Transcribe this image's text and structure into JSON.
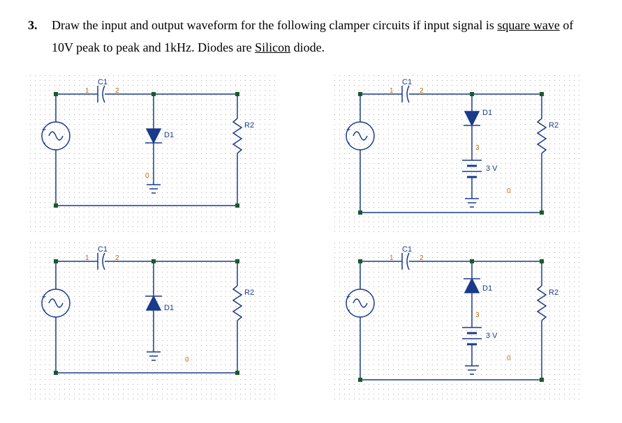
{
  "question": {
    "number": "3.",
    "text_before_underline1": "Draw the input and output waveform for the following clamper circuits if input signal is ",
    "underline1": "square wave",
    "text_middle": " of 10V peak to peak and 1kHz. Diodes are ",
    "underline2": "Silicon",
    "text_after": " diode."
  },
  "components": {
    "cap": "C1",
    "diode": "D1",
    "res": "R2",
    "batt": "3 V"
  },
  "nodes": {
    "n0": "0",
    "n1": "1",
    "n2": "2",
    "n3": "3"
  },
  "circuits": [
    {
      "diode_direction": "down",
      "has_battery": false
    },
    {
      "diode_direction": "down",
      "has_battery": true
    },
    {
      "diode_direction": "up",
      "has_battery": false
    },
    {
      "diode_direction": "up",
      "has_battery": true
    }
  ]
}
